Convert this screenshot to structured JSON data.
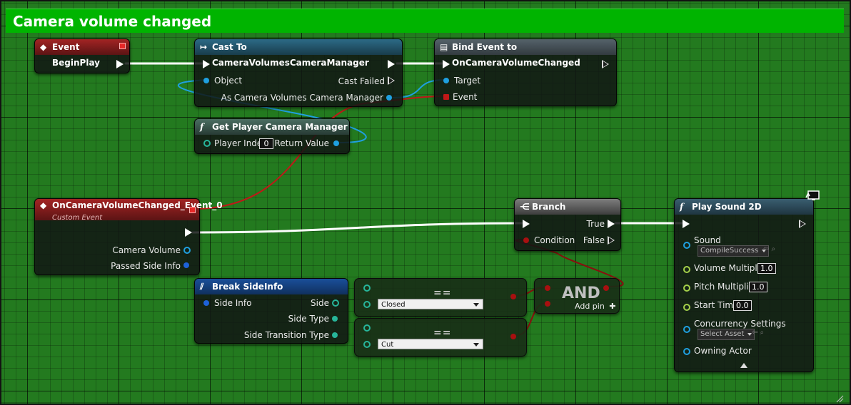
{
  "comment": {
    "title": "Camera volume changed"
  },
  "event_begin_play": {
    "title": "Event BeginPlay"
  },
  "cast_node": {
    "title": "Cast To CameraVolumesCameraManager",
    "object_label": "Object",
    "cast_failed_label": "Cast Failed",
    "as_label": "As Camera Volumes Camera Manager"
  },
  "bind_node": {
    "title": "Bind Event to OnCameraVolumeChanged",
    "target_label": "Target",
    "event_label": "Event"
  },
  "get_pcm_node": {
    "title": "Get Player Camera Manager",
    "player_index_label": "Player Index",
    "player_index_value": "0",
    "return_label": "Return Value"
  },
  "custom_event": {
    "title": "OnCameraVolumeChanged_Event_0",
    "subtitle": "Custom Event",
    "camera_volume_label": "Camera Volume",
    "passed_side_label": "Passed Side Info"
  },
  "break_node": {
    "title": "Break SideInfo",
    "side_info_label": "Side Info",
    "side_label": "Side",
    "side_type_label": "Side Type",
    "side_transition_label": "Side Transition Type"
  },
  "equal_nodes": [
    {
      "operator": "==",
      "value": "Closed"
    },
    {
      "operator": "==",
      "value": "Cut"
    }
  ],
  "and_node": {
    "title": "AND",
    "add_pin_label": "Add pin"
  },
  "branch_node": {
    "title": "Branch",
    "condition_label": "Condition",
    "true_label": "True",
    "false_label": "False"
  },
  "play_node": {
    "title": "Play Sound 2D",
    "sound_label": "Sound",
    "sound_asset": "CompileSuccess",
    "volume_label": "Volume Multiplier",
    "volume_value": "1.0",
    "pitch_label": "Pitch Multiplier",
    "pitch_value": "1.0",
    "start_label": "Start Time",
    "start_value": "0.0",
    "concurrency_label": "Concurrency Settings",
    "concurrency_asset": "Select Asset",
    "owning_label": "Owning Actor"
  },
  "icons": {
    "event": "event-diamond-icon",
    "cast": "cast-arrow-icon",
    "bind": "bind-event-icon",
    "function": "function-f-icon",
    "branch": "branch-icon",
    "break": "break-struct-icon",
    "client": "client-monitor-icon"
  },
  "colors": {
    "comment": "#00b400",
    "grid": "#237a1f",
    "exec_wire": "#ffffff",
    "object_wire": "#1fa0e0",
    "delegate_wire": "#c01818",
    "bool_wire": "#8a0e0e"
  }
}
